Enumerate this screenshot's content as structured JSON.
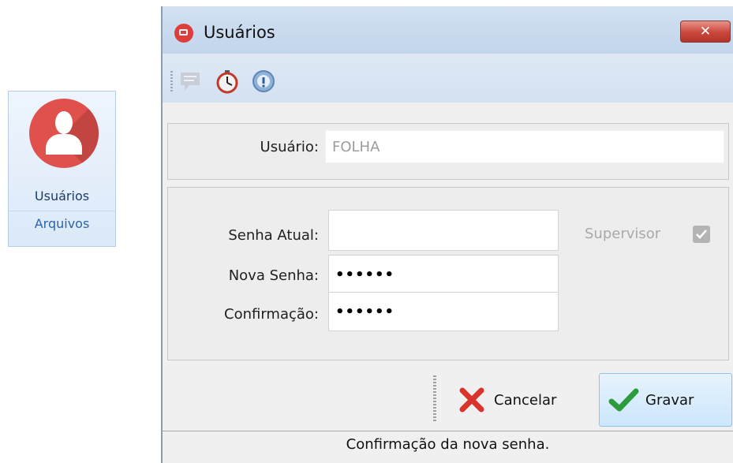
{
  "ribbon": {
    "button_label": "Usuários",
    "group_label": "Arquivos",
    "icon": "user-icon",
    "accent_color": "#e0514e"
  },
  "window": {
    "title": "Usuários",
    "close_label": "✕"
  },
  "toolbar": {
    "items": [
      {
        "icon": "chat-icon"
      },
      {
        "icon": "stopwatch-icon"
      },
      {
        "icon": "info-icon"
      }
    ]
  },
  "form": {
    "user_label": "Usuário:",
    "user_value": "FOLHA",
    "current_password_label": "Senha Atual:",
    "current_password_value": "",
    "new_password_label": "Nova Senha:",
    "new_password_value": "••••••",
    "confirm_label": "Confirmação:",
    "confirm_value": "••••••",
    "supervisor_label": "Supervisor",
    "supervisor_checked": true
  },
  "actions": {
    "cancel_label": "Cancelar",
    "save_label": "Gravar"
  },
  "status": {
    "text": "Confirmação da nova senha."
  }
}
